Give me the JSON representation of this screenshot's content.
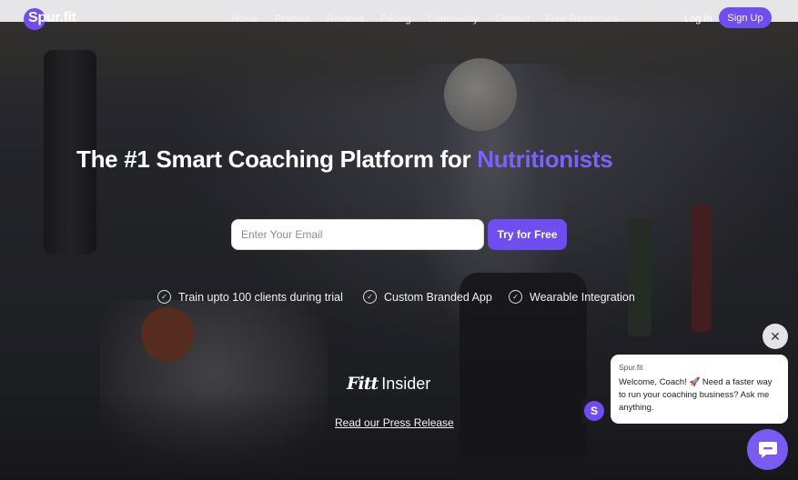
{
  "nav": {
    "logo_text": "Spur.fit",
    "menu": [
      "Home",
      "Product",
      "Reviews",
      "Pricing",
      "Community",
      "Contact",
      "Free Resources"
    ],
    "login_label": "Log In",
    "signup_label": "Sign Up"
  },
  "hero": {
    "headline_prefix": "The #1 Smart Coaching Platform for ",
    "headline_accent": "Nutritionists",
    "email_placeholder": "Enter Your Email",
    "cta_label": "Try for Free",
    "features": [
      "Train upto 100 clients during trial",
      "Custom Branded App",
      "Wearable Integration"
    ],
    "press_logo_part1": "Fitt",
    "press_logo_part2": "Insider",
    "press_link": "Read our Press Release"
  },
  "chat": {
    "close_symbol": "✕",
    "avatar_letter": "S",
    "sender": "Spur.fit",
    "message": "Welcome, Coach! 🚀 Need a faster way to run your coaching business? Ask me anything."
  },
  "colors": {
    "accent": "#6f4df0",
    "headline_accent": "#7b62f7"
  },
  "icons": [
    "check-circle-icon",
    "close-icon",
    "chat-icon"
  ]
}
